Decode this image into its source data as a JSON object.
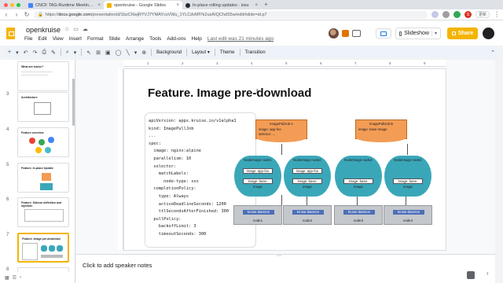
{
  "browser": {
    "tabs": [
      {
        "title": "CNCF TAG-Runtime Meeting N",
        "active": false,
        "favicon_color": "#4285f4"
      },
      {
        "title": "openkruise - Google Slides",
        "active": true,
        "favicon_color": "#f4b400"
      },
      {
        "title": "In-place rolling updates · issu",
        "active": false,
        "favicon_color": "#24292e"
      }
    ],
    "new_tab_label": "+",
    "url_prefix": "https://",
    "url_host": "docs.google.com",
    "url_path": "/presentation/d/1bzCNwjRYVJ7YMAYcsVWu_1YLCdvMfYk2uzAIQChdS5w/edit#slide=id.p7",
    "update_label": "更新",
    "profile_initial": "S"
  },
  "doc": {
    "title": "openkruise",
    "menu": [
      "File",
      "Edit",
      "View",
      "Insert",
      "Format",
      "Slide",
      "Arrange",
      "Tools",
      "Add-ons",
      "Help"
    ],
    "last_edit": "Last edit was 21 minutes ago",
    "slideshow_label": "Slideshow",
    "share_label": "Share"
  },
  "toolbar": {
    "background_label": "Background",
    "layout_label": "Layout",
    "theme_label": "Theme",
    "transition_label": "Transition"
  },
  "ruler": [
    "1",
    "2",
    "3",
    "4",
    "5",
    "6",
    "7",
    "8",
    "9"
  ],
  "filmstrip": {
    "items": [
      {
        "num": "",
        "title": "What are kruise?"
      },
      {
        "num": "3",
        "title": "Architecture"
      },
      {
        "num": "4",
        "title": "Feature overview"
      },
      {
        "num": "5",
        "title": "Feature. In-place Update"
      },
      {
        "num": "6",
        "title": "Feature. Sidecar definition and injection"
      },
      {
        "num": "7",
        "title": "Feature. Image pre-download"
      },
      {
        "num": "8",
        "title": ""
      }
    ]
  },
  "slide": {
    "title": "Feature. Image pre-download",
    "code": [
      "apiVersion: apps.kruise.io/v1alpha1",
      "kind: ImagePullJob",
      "...",
      "spec:",
      "  image: nginx:alpine",
      "  parallelism: 10",
      "  selector:",
      "    matchLabels:",
      "      node-type: xxx",
      "  completionPolicy:",
      "    type: Always",
      "    activeDeadlineSeconds: 1200",
      "    ttlSecondsAfterFinished: 300",
      "  pullPolicy:",
      "    backoffLimit: 3",
      "    timeoutSeconds: 300"
    ],
    "jobs": [
      {
        "title": "ImagePullJob A",
        "line1": "image: app-foo",
        "line2": "selector: ..."
      },
      {
        "title": "ImagePullJob B",
        "line1": "image: base-image",
        "line2": ""
      }
    ],
    "nodeimages": [
      {
        "label": "NodeImage node1",
        "images": [
          "image: app-foo",
          "image: base-image"
        ]
      },
      {
        "label": "NodeImage node2",
        "images": [
          "image: app-foo",
          "image: base-image"
        ]
      },
      {
        "label": "NodeImage node3",
        "images": [
          "",
          "image: base-image"
        ]
      },
      {
        "label": "NodeImage node4",
        "images": [
          "",
          "image: base-image"
        ]
      }
    ],
    "daemons": [
      {
        "daemon": "kruise-daemon",
        "node": "node1"
      },
      {
        "daemon": "kruise-daemon",
        "node": "node2"
      },
      {
        "daemon": "kruise-daemon",
        "node": "node3"
      },
      {
        "daemon": "kruise-daemon",
        "node": "node4"
      }
    ]
  },
  "notes": {
    "placeholder": "Click to add speaker notes"
  },
  "colors": {
    "accent": "#f4b400",
    "job_orange": "#f39c55",
    "node_teal": "#3aa7b9",
    "daemon_blue": "#4c6fb8"
  }
}
